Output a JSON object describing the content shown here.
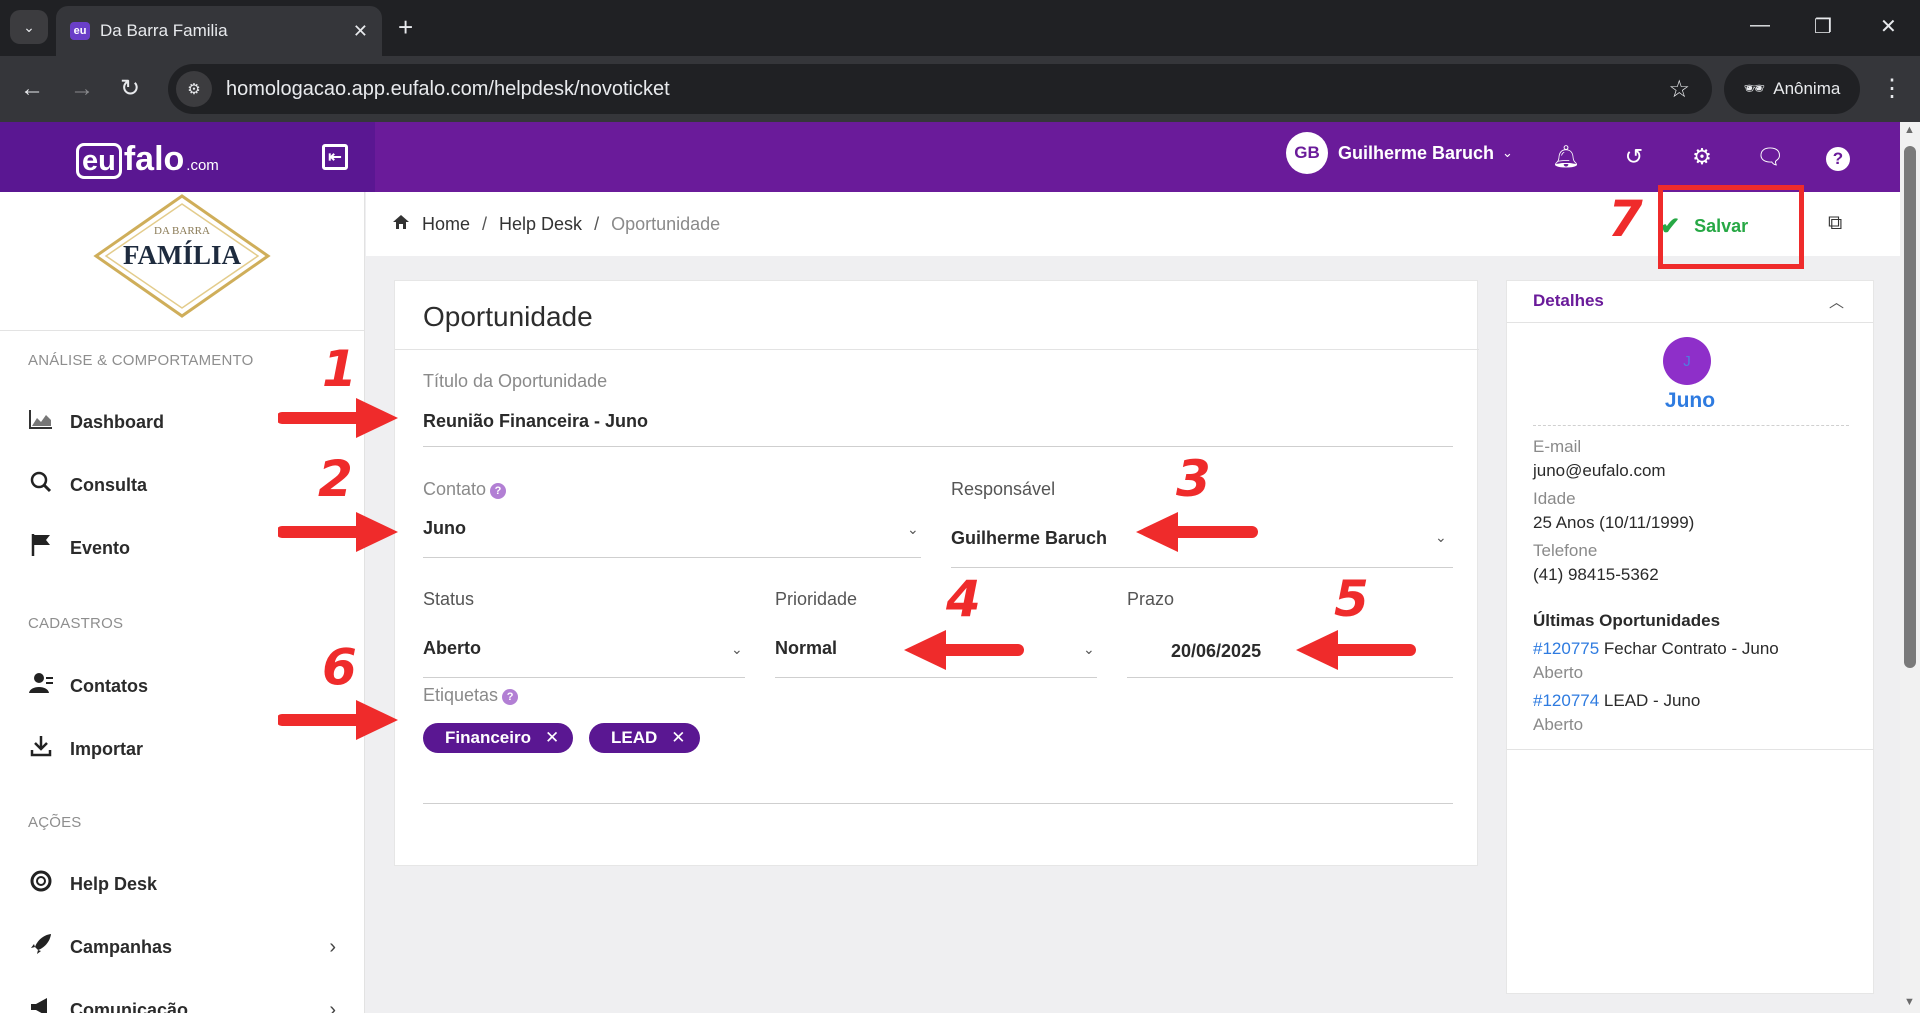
{
  "browser": {
    "tab_title": "Da Barra Familia",
    "favicon_text": "eu",
    "url": "homologacao.app.eufalo.com/helpdesk/novoticket",
    "profile_label": "Anônima"
  },
  "header": {
    "logo_eu": "eu",
    "logo_falo": "falo",
    "logo_com": ".com",
    "user_initials": "GB",
    "user_name": "Guilherme Baruch",
    "icons": [
      "bell-icon",
      "history-icon",
      "gear-icon",
      "chat-icon",
      "help-icon"
    ]
  },
  "sidebar": {
    "client_logo": {
      "top": "DA BARRA",
      "main": "FAMÍLIA"
    },
    "sections": [
      {
        "title": "ANÁLISE & COMPORTAMENTO",
        "items": [
          {
            "label": "Dashboard",
            "icon": "chart-icon"
          },
          {
            "label": "Consulta",
            "icon": "search-icon"
          },
          {
            "label": "Evento",
            "icon": "flag-icon"
          }
        ]
      },
      {
        "title": "CADASTROS",
        "items": [
          {
            "label": "Contatos",
            "icon": "contacts-icon"
          },
          {
            "label": "Importar",
            "icon": "download-icon"
          }
        ]
      },
      {
        "title": "AÇÕES",
        "items": [
          {
            "label": "Help Desk",
            "icon": "lifebuoy-icon"
          },
          {
            "label": "Campanhas",
            "icon": "rocket-icon"
          },
          {
            "label": "Comunicação",
            "icon": "megaphone-icon"
          }
        ]
      }
    ]
  },
  "breadcrumb": {
    "home": "Home",
    "section": "Help Desk",
    "current": "Oportunidade"
  },
  "actions": {
    "save_label": "Salvar"
  },
  "form": {
    "title": "Oportunidade",
    "titulo_label": "Título da Oportunidade",
    "titulo_value": "Reunião Financeira - Juno",
    "contato_label": "Contato",
    "contato_value": "Juno",
    "responsavel_label": "Responsável",
    "responsavel_value": "Guilherme Baruch",
    "status_label": "Status",
    "status_value": "Aberto",
    "prioridade_label": "Prioridade",
    "prioridade_value": "Normal",
    "prazo_label": "Prazo",
    "prazo_value": "20/06/2025",
    "etiquetas_label": "Etiquetas",
    "tags": [
      "Financeiro",
      "LEAD"
    ]
  },
  "details": {
    "title": "Detalhes",
    "avatar_initial": "J",
    "contact_name": "Juno",
    "email_label": "E-mail",
    "email_value": "juno@eufalo.com",
    "idade_label": "Idade",
    "idade_value": "25 Anos (10/11/1999)",
    "telefone_label": "Telefone",
    "telefone_value": "(41) 98415-5362",
    "ultimas_label": "Últimas Oportunidades",
    "opportunities": [
      {
        "id": "#120775",
        "name": "Fechar Contrato - Juno",
        "status": "Aberto"
      },
      {
        "id": "#120774",
        "name": "LEAD - Juno",
        "status": "Aberto"
      }
    ]
  },
  "annotations": [
    "1",
    "2",
    "3",
    "4",
    "5",
    "6",
    "7"
  ],
  "colors": {
    "brand": "#6a1b9a",
    "save": "#27a845",
    "annotation": "#ef2b2b",
    "link": "#2e7be0"
  }
}
